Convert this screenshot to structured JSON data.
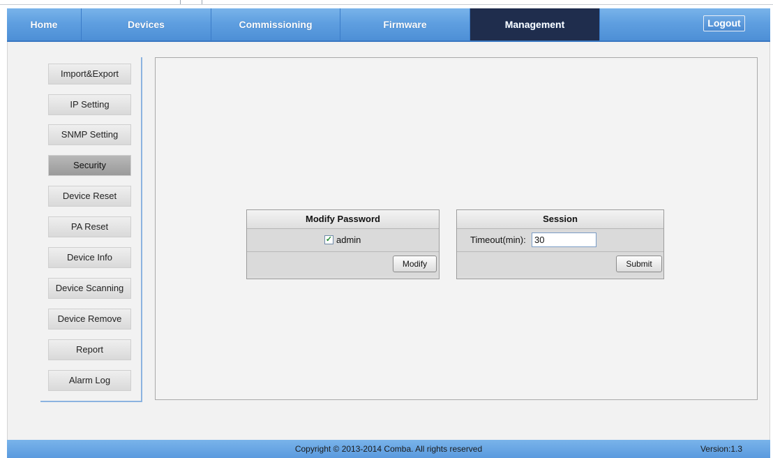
{
  "nav": {
    "items": [
      {
        "label": "Home"
      },
      {
        "label": "Devices"
      },
      {
        "label": "Commissioning"
      },
      {
        "label": "Firmware"
      },
      {
        "label": "Management"
      }
    ],
    "active": "Management",
    "logout_label": "Logout"
  },
  "sidebar": {
    "items": [
      {
        "label": "Import&Export"
      },
      {
        "label": "IP Setting"
      },
      {
        "label": "SNMP Setting"
      },
      {
        "label": "Security"
      },
      {
        "label": "Device Reset"
      },
      {
        "label": "PA Reset"
      },
      {
        "label": "Device Info"
      },
      {
        "label": "Device Scanning"
      },
      {
        "label": "Device Remove"
      },
      {
        "label": "Report"
      },
      {
        "label": "Alarm Log"
      }
    ],
    "active": "Security"
  },
  "modify_password": {
    "title": "Modify Password",
    "user_label": "admin",
    "user_checked": true,
    "button_label": "Modify"
  },
  "session": {
    "title": "Session",
    "timeout_label": "Timeout(min):",
    "timeout_value": "30",
    "button_label": "Submit"
  },
  "footer": {
    "copyright": "Copyright © 2013-2014 Comba. All rights reserved",
    "version": "Version:1.3"
  },
  "colors": {
    "nav_blue": "#5f9fe0",
    "nav_active": "#1f2d4d",
    "sidebar_border": "#8bb3e0"
  }
}
